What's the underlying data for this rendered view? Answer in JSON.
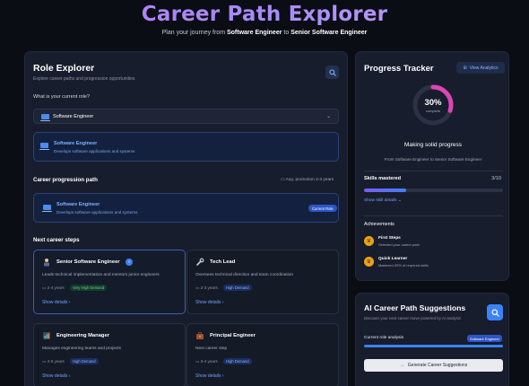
{
  "header": {
    "title": "Career Path Explorer",
    "subtitle_prefix": "Plan your journey from",
    "from_role": "Software Engineer",
    "subtitle_mid": "to",
    "to_role": "Senior Software Engineer"
  },
  "explorer": {
    "title": "Role Explorer",
    "subtitle": "Explore career paths and progression opportunities",
    "current_role_label": "What is your current role?",
    "selected_role": "Software Engineer",
    "selected_card": {
      "title": "Software Engineer",
      "desc": "Develops software applications and systems"
    },
    "progression": {
      "heading": "Career progression path",
      "avg_promotion": "Avg. promotion 2-3 years",
      "current": {
        "title": "Software Engineer",
        "desc": "Develops software applications and systems",
        "badge": "Current Role"
      }
    },
    "next_steps_heading": "Next career steps",
    "next_steps": [
      {
        "title": "Senior Software Engineer",
        "desc": "Leads technical implementation and mentors junior engineers",
        "years": "2-4 years",
        "demand": "Very High Demand",
        "details": "Show details",
        "icon": "person-icon"
      },
      {
        "title": "Tech Lead",
        "desc": "Oversees technical direction and team coordination",
        "years": "2-3 years",
        "demand": "High Demand",
        "details": "Show details",
        "icon": "wrench-icon"
      },
      {
        "title": "Engineering Manager",
        "desc": "Manages engineering teams and projects",
        "years": "4-5 years",
        "demand": "High Demand",
        "details": "Show details",
        "icon": "chart-icon"
      },
      {
        "title": "Principal Engineer",
        "desc": "Next career step",
        "years": "3-4 years",
        "demand": "High Demand",
        "details": "Show details",
        "icon": "briefcase-icon"
      }
    ]
  },
  "tracker": {
    "title": "Progress Tracker",
    "view_analytics": "View Analytics",
    "percent_text": "30%",
    "percent_value": 0.3,
    "complete_label": "complete",
    "status": "Making solid progress",
    "status_sub": "From Software Engineer to Senior Software Engineer",
    "skills_label": "Skills mastered",
    "skills_count": "3/10",
    "skills_fraction": 0.3,
    "show_skill_details": "Show skill details",
    "achievements_heading": "Achievements",
    "achievements": [
      {
        "title": "First Steps",
        "desc": "Selected your career path"
      },
      {
        "title": "Quick Learner",
        "desc": "Mastered 20% of required skills"
      }
    ]
  },
  "ai": {
    "title": "AI Career Path Suggestions",
    "subtitle": "Discover your next career move powered by AI analysis",
    "analysis_label": "Current role analysis",
    "analysis_badge": "Software Engineer",
    "generate_button": "Generate Career Suggestions"
  },
  "colors": {
    "accent_blue": "#3b82f6",
    "accent_purple": "#a78bfa",
    "achievement_gold": "#e8a317"
  }
}
